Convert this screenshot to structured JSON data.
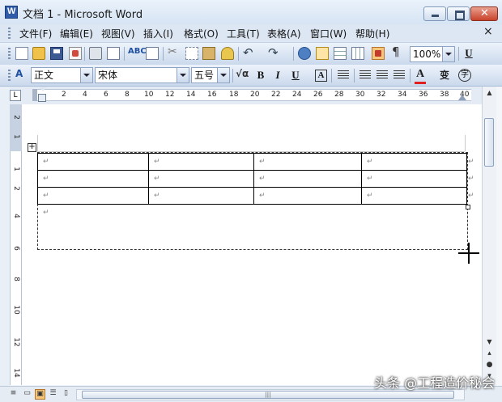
{
  "window": {
    "title": "文档 1 - Microsoft Word"
  },
  "menu": {
    "items": [
      "文件(F)",
      "编辑(E)",
      "视图(V)",
      "插入(I)",
      "格式(O)",
      "工具(T)",
      "表格(A)",
      "窗口(W)",
      "帮助(H)"
    ],
    "close_glyph": "×"
  },
  "standard_toolbar": {
    "zoom": "100%",
    "icons": [
      "new-document-icon",
      "open-folder-icon",
      "save-icon",
      "permission-icon",
      "print-icon",
      "print-preview-icon",
      "spelling-icon",
      "research-icon",
      "cut-icon",
      "copy-icon",
      "paste-icon",
      "format-painter-icon",
      "undo-icon",
      "redo-icon",
      "hyperlink-icon",
      "tables-borders-icon",
      "insert-table-icon",
      "columns-icon",
      "drawing-icon",
      "show-hide-icon"
    ]
  },
  "formatting_toolbar": {
    "style": "正文",
    "font": "宋体",
    "size": "五号",
    "bold": "B",
    "italic": "I",
    "underline": "U",
    "char_border": "A",
    "font_color_letter": "A",
    "enclose_char": "字",
    "accent_font_color": "#e02020"
  },
  "ruler": {
    "corner": "L",
    "h_numbers": [
      "2",
      "4",
      "6",
      "8",
      "10",
      "12",
      "14",
      "16",
      "18",
      "20",
      "22",
      "24",
      "26",
      "28",
      "30",
      "32",
      "34",
      "36",
      "38",
      "40"
    ],
    "v_numbers": [
      "2",
      "1",
      "1",
      "2",
      "4",
      "6",
      "8",
      "10",
      "12",
      "14"
    ]
  },
  "document": {
    "table": {
      "rows": 3,
      "cols": 4,
      "cell_mark": "↵"
    },
    "paragraph_mark": "↵",
    "move_handle_glyph": "+"
  },
  "status": {
    "watermark": "头条 @工程造价秘会"
  }
}
